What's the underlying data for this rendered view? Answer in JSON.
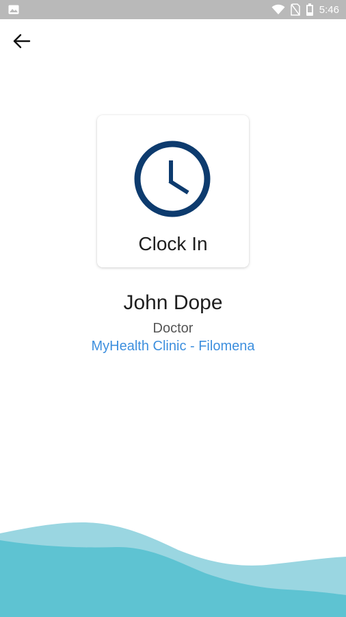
{
  "status_bar": {
    "time": "5:46",
    "icons": [
      "image-icon",
      "wifi-icon",
      "no-sim-icon",
      "battery-icon"
    ]
  },
  "app_bar": {
    "back_icon": "arrow-left-icon"
  },
  "clock_card": {
    "icon": "clock-icon",
    "label": "Clock In",
    "icon_color": "#0d3b6e"
  },
  "profile": {
    "name": "John Dope",
    "role": "Doctor",
    "clinic": "MyHealth Clinic - Filomena",
    "clinic_color": "#3d8fde"
  },
  "theme": {
    "wave_light": "#9ad6e1",
    "wave_dark": "#5ec3d2"
  }
}
